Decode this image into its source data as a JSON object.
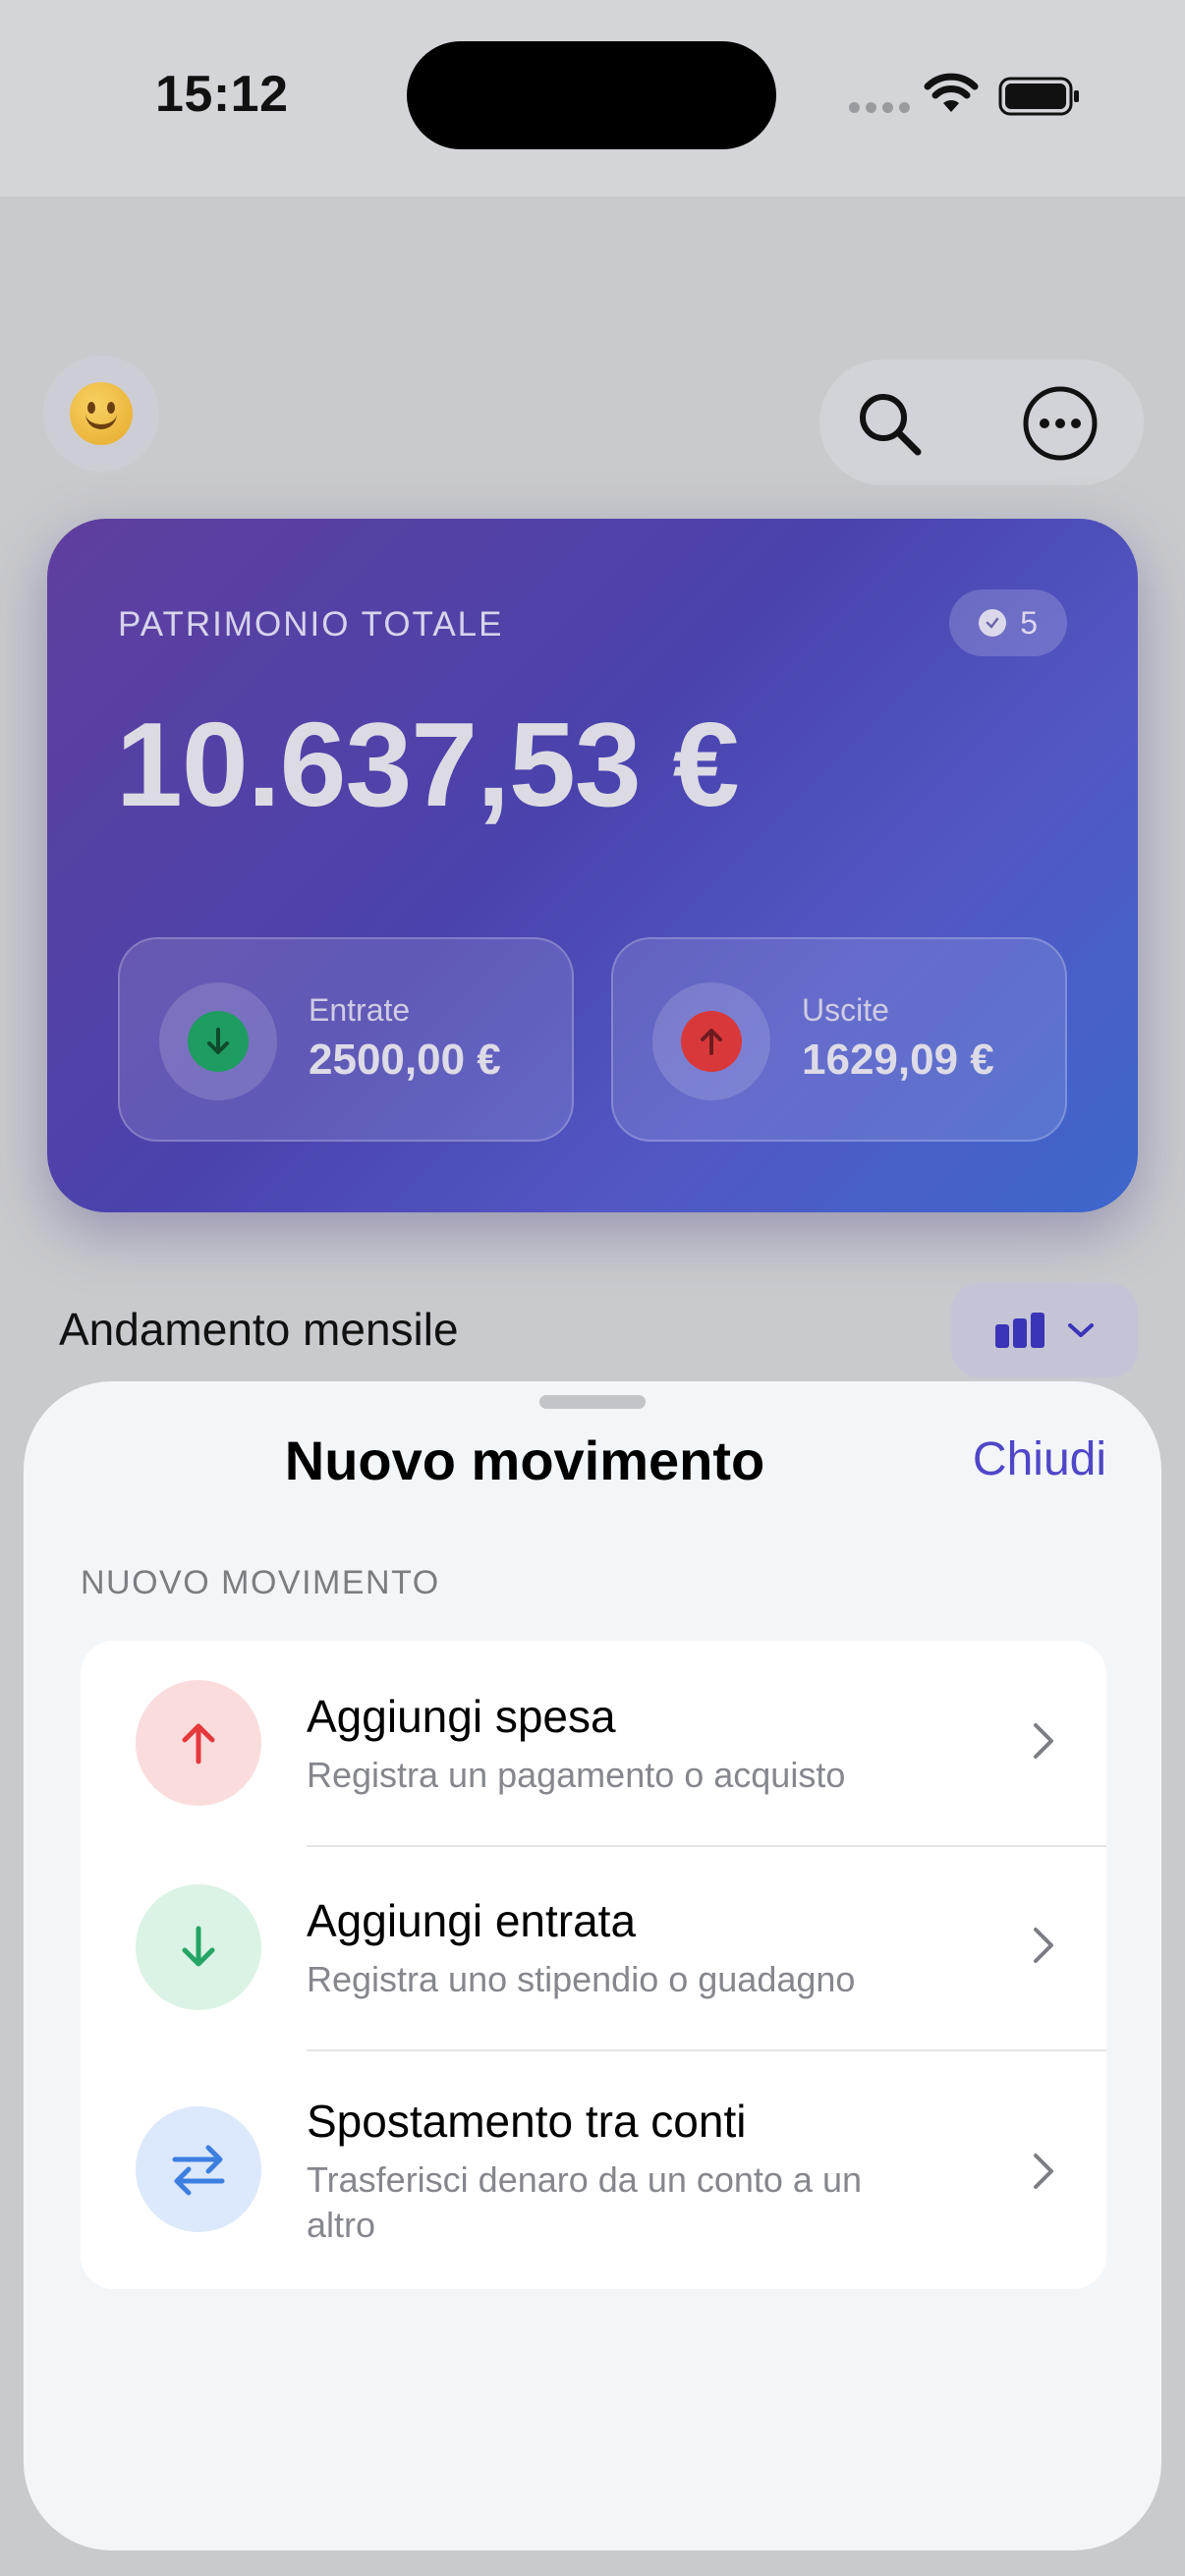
{
  "status_bar": {
    "time": "15:12"
  },
  "header": {
    "avatar_icon": "smiling-face-emoji",
    "search_icon": "magnifying-glass",
    "more_icon": "ellipsis-circle"
  },
  "balance_card": {
    "label": "PATRIMONIO TOTALE",
    "badge_count": "5",
    "total": "10.637,53 €",
    "income": {
      "label": "Entrate",
      "value": "2500,00 €",
      "color": "#1f9c61"
    },
    "expense": {
      "label": "Uscite",
      "value": "1629,09 €",
      "color": "#d8383a"
    }
  },
  "trend_section": {
    "title": "Andamento mensile"
  },
  "sheet": {
    "title": "Nuovo movimento",
    "close_label": "Chiudi",
    "section_header": "NUOVO MOVIMENTO",
    "options": [
      {
        "title": "Aggiungi spesa",
        "subtitle": "Registra un pagamento o acquisto",
        "icon": "arrow-up",
        "icon_color": "#e5393c",
        "icon_bg": "#fadcdd"
      },
      {
        "title": "Aggiungi entrata",
        "subtitle": "Registra uno stipendio o guadagno",
        "icon": "arrow-down",
        "icon_color": "#25a565",
        "icon_bg": "#daf3e4"
      },
      {
        "title": "Spostamento tra conti",
        "subtitle": "Trasferisci denaro da un conto a un altro",
        "icon": "arrows-left-right",
        "icon_color": "#3d7fe0",
        "icon_bg": "#dce8fb"
      }
    ]
  },
  "colors": {
    "accent": "#4f47c7"
  }
}
